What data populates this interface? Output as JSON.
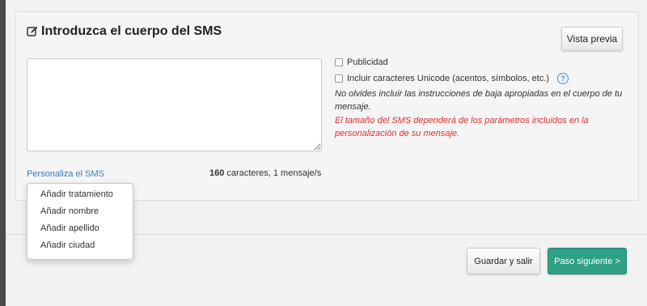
{
  "header": {
    "title": "Introduzca el cuerpo del SMS",
    "title_icon": "edit-icon"
  },
  "actions": {
    "preview_label": "Vista previa"
  },
  "message": {
    "value": "",
    "placeholder": ""
  },
  "options": {
    "publicidad_label": "Publicidad",
    "unicode_label": "Incluir caracteres Unicode (acentos, símbolos, etc.)",
    "help_icon": "question-circle-icon",
    "help_glyph": "?"
  },
  "notes": {
    "baja": "No olvides incluir las instrucciones de baja apropiadas en el cuerpo de tu mensaje.",
    "warning": "El tamaño del SMS dependerá de los parámetros incluidos en la personalización de su mensaje."
  },
  "personalize": {
    "link_label": "Personaliza el SMS",
    "items": [
      "Añadir tratamiento",
      "Añadir nombre",
      "Añadir apellido",
      "Añadir ciudad"
    ]
  },
  "counter": {
    "count": "160",
    "suffix": " caracteres, 1 mensaje/s"
  },
  "footer": {
    "save_label": "Guardar y salir",
    "next_label": "Paso siguiente >"
  },
  "colors": {
    "accent": "#2fa086",
    "link": "#3a7bbf",
    "warning": "#e03030",
    "help": "#4a90c8"
  }
}
